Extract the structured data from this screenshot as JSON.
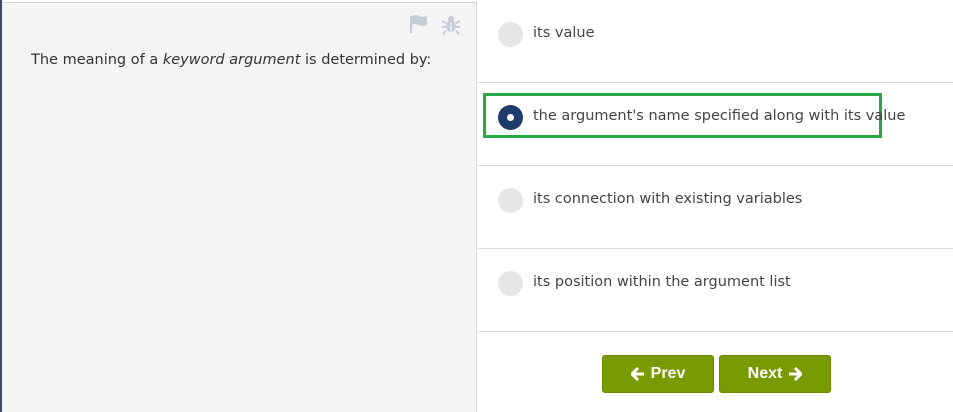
{
  "question": {
    "text_before": "The meaning of a ",
    "text_em": "keyword argument",
    "text_after": " is determined by:"
  },
  "toolbar": {
    "flag_icon": "flag-icon",
    "bug_icon": "bug-icon"
  },
  "answers": [
    {
      "label": "its value",
      "selected": false
    },
    {
      "label": "the argument's name specified along with its value",
      "selected": true
    },
    {
      "label": "its connection with existing variables",
      "selected": false
    },
    {
      "label": "its position within the argument list",
      "selected": false
    }
  ],
  "navigation": {
    "prev_label": "Prev",
    "next_label": "Next",
    "prev_arrow": "🡐",
    "next_arrow": "🡒"
  },
  "colors": {
    "button_green": "#7a9a01",
    "selected_radio": "#1f3a6b",
    "highlight": "#28a745"
  }
}
